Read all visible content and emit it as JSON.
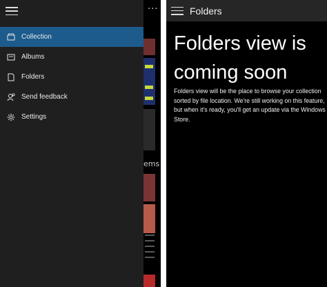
{
  "left": {
    "background": {
      "more_label": "···",
      "fragment_text": "ems"
    },
    "nav": {
      "items": [
        {
          "label": "Collection",
          "icon": "collection-icon",
          "active": true
        },
        {
          "label": "Albums",
          "icon": "albums-icon",
          "active": false
        },
        {
          "label": "Folders",
          "icon": "folder-icon",
          "active": false
        },
        {
          "label": "Send feedback",
          "icon": "feedback-icon",
          "active": false
        },
        {
          "label": "Settings",
          "icon": "gear-icon",
          "active": false
        }
      ]
    }
  },
  "right": {
    "header": {
      "title": "Folders"
    },
    "message": {
      "heading": "Folders view is coming soon",
      "body": "Folders view will be the place to browse your collection sorted by file location. We're still working on this feature, but when it's ready, you'll get an update via the Windows Store."
    }
  },
  "colors": {
    "accent": "#1c5b8c",
    "nav_background": "#1f1f1f",
    "header_background": "#262626",
    "page_background": "#000000"
  }
}
